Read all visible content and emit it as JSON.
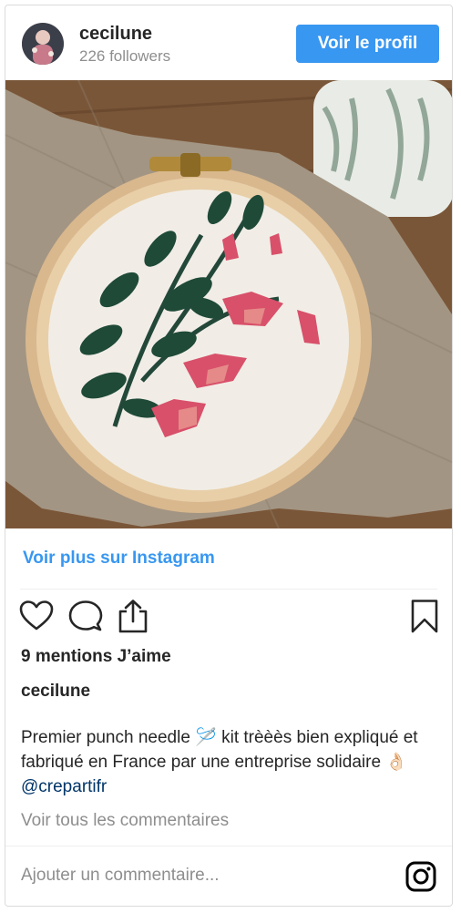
{
  "header": {
    "username": "cecilune",
    "followers": "226 followers",
    "profile_button": "Voir le profil"
  },
  "post": {
    "more_link": "Voir plus sur Instagram",
    "likes": "9 mentions J’aime",
    "caption_username": "cecilune",
    "caption_before_mention": "Premier punch needle 🪡 kit trèèès bien expliqué et fabriqué en France par une entreprise solidaire 👌🏻",
    "caption_mention": "@crepartifr",
    "all_comments": "Voir tous les commentaires"
  },
  "comment_bar": {
    "placeholder": "Ajouter un commentaire..."
  },
  "icons": {
    "like": "heart-icon",
    "comment": "comment-icon",
    "share": "share-icon",
    "save": "bookmark-icon",
    "instagram": "instagram-icon"
  },
  "colors": {
    "accent": "#3897f0",
    "text": "#262626",
    "muted": "#8e8e8e",
    "mention": "#003569"
  }
}
